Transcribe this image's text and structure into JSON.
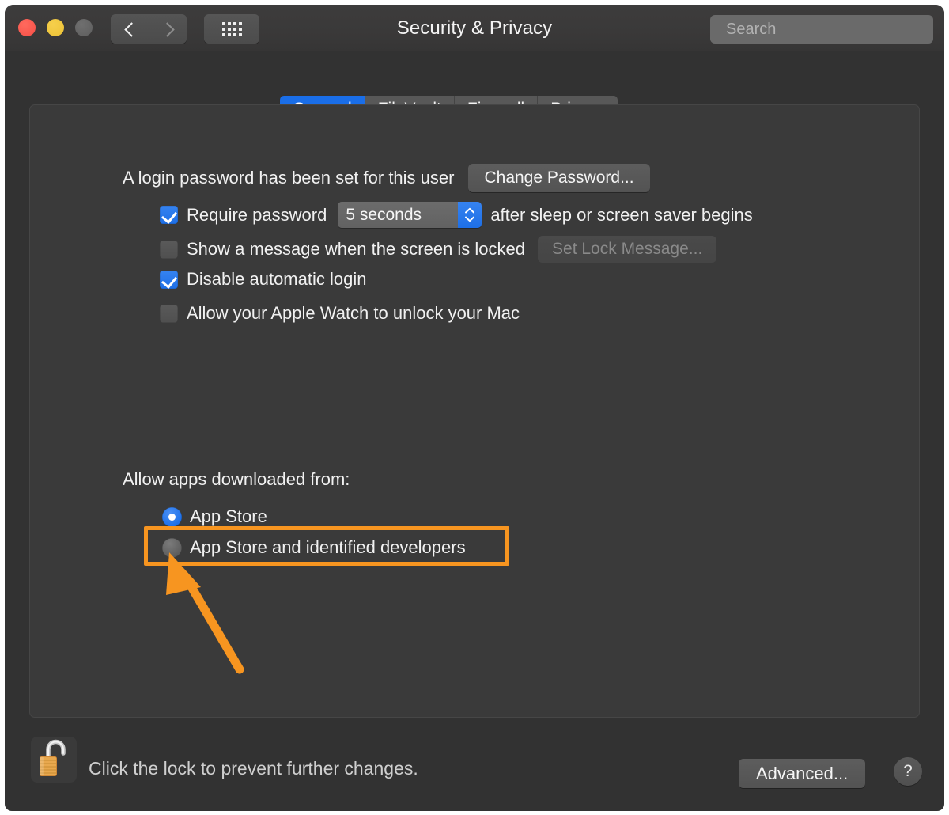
{
  "window": {
    "title": "Security & Privacy",
    "traffic_lights": [
      "close",
      "minimize",
      "maximize"
    ],
    "nav": {
      "back_icon": "chevron-left-icon",
      "forward_icon": "chevron-right-icon"
    },
    "grid_icon": "show-all-grid-icon"
  },
  "search": {
    "placeholder": "Search",
    "value": "",
    "icon": "search-icon"
  },
  "tabs": [
    {
      "label": "General",
      "active": true
    },
    {
      "label": "FileVault",
      "active": false
    },
    {
      "label": "Firewall",
      "active": false
    },
    {
      "label": "Privacy",
      "active": false
    }
  ],
  "general": {
    "password_status": "A login password has been set for this user",
    "change_password_label": "Change Password...",
    "options": [
      {
        "label": "Require password",
        "checked": true,
        "suffix": "after sleep or screen saver begins",
        "combo": {
          "value": "5 seconds",
          "stepper_icon": "stepper-up-down-icon"
        }
      },
      {
        "label": "Show a message when the screen is locked",
        "checked": false,
        "button": {
          "label": "Set Lock Message...",
          "disabled": true
        }
      },
      {
        "label": "Disable automatic login",
        "checked": true
      },
      {
        "label": "Allow your Apple Watch to unlock your Mac",
        "checked": false
      }
    ],
    "allow_apps_title": "Allow apps downloaded from:",
    "allow_apps_options": [
      {
        "label": "App Store",
        "selected": true
      },
      {
        "label": "App Store and identified developers",
        "selected": false
      }
    ]
  },
  "annotation": {
    "highlight_target": "App Store and identified developers",
    "color": "#f79520",
    "arrow": "points-up-left-to-radio"
  },
  "footer": {
    "lock_icon": "open-padlock-icon",
    "lock_text": "Click the lock to prevent further changes.",
    "advanced_label": "Advanced...",
    "help_label": "?"
  },
  "colors": {
    "accent": "#1a6ee8",
    "window_bg": "#323232",
    "panel_bg": "#3a3a3a",
    "titlebar_bg": "#3a3939",
    "annotation": "#f79520"
  }
}
